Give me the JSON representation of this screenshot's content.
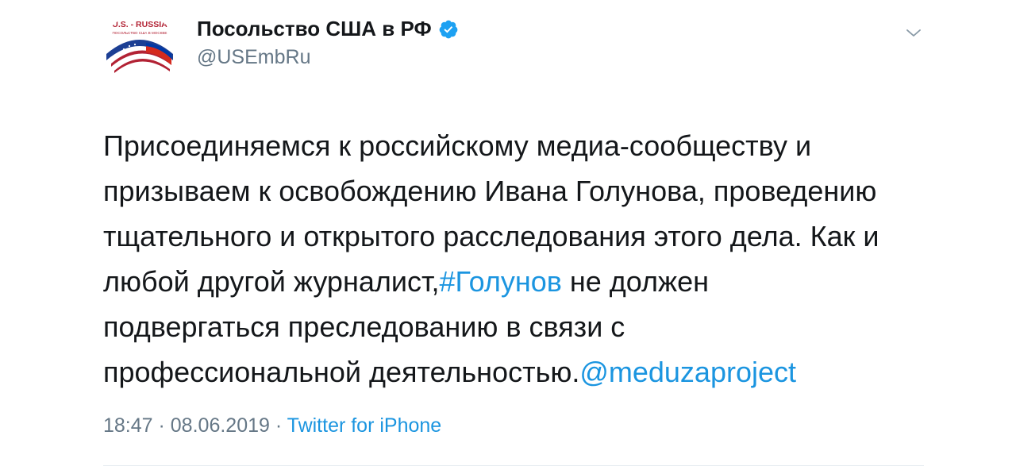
{
  "account": {
    "display_name": "Посольство США в РФ",
    "handle": "@USEmbRu",
    "verified": true,
    "avatar": {
      "logo_text": "U.S. - RUSSIA",
      "logo_subtext": "ПОСОЛЬСТВО США В МОСКВЕ",
      "icon": "us-russia-flags-logo"
    }
  },
  "tweet": {
    "text_lines": [
      "Присоединяемся к российскому медиа-сообществу и",
      "призываем к освобождению Ивана Голунова, проведению",
      "тщательного и открытого расследования этого дела. Как и",
      "любой другой журналист,"
    ],
    "hashtag": "#Голунов",
    "after_hashtag": " не должен",
    "line5": "подвергаться преследованию в связи с",
    "line6_text": "профессиональной деятельностью.",
    "mention": "@meduzaproject"
  },
  "meta": {
    "time": "18:47",
    "sep1": " · ",
    "date": "08.06.2019",
    "sep2": " · ",
    "source": "Twitter for iPhone"
  },
  "colors": {
    "link": "#1b95e0",
    "text": "#14171a",
    "secondary": "#657786",
    "verified": "#1da1f2"
  },
  "icons": {
    "menu": "chevron-down-icon",
    "verified": "verified-badge-icon"
  }
}
